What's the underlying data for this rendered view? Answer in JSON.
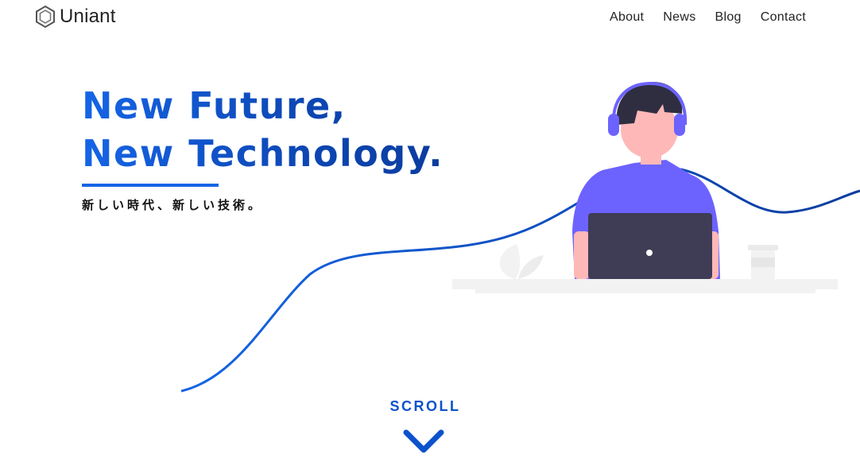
{
  "header": {
    "brand": "Uniant",
    "nav": [
      {
        "label": "About"
      },
      {
        "label": "News"
      },
      {
        "label": "Blog"
      },
      {
        "label": "Contact"
      }
    ]
  },
  "hero": {
    "title_line1": "New Future,",
    "title_line2": "New Technology.",
    "subtitle": "新しい時代、新しい技術。"
  },
  "scroll": {
    "label": "SCROLL",
    "icon": "chevron-down-icon"
  },
  "colors": {
    "accent": "#1565e6",
    "accent_dark": "#0a3c9e",
    "person_shirt": "#6c63ff",
    "laptop": "#3f3d56",
    "skin": "#ffb8b8",
    "hair": "#2f2e41",
    "desk": "#f2f2f2"
  }
}
